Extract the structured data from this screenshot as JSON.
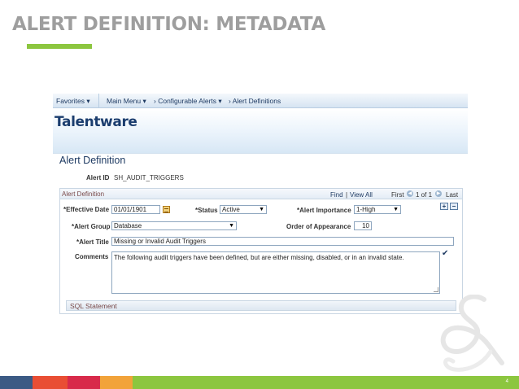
{
  "slide": {
    "title": "ALERT DEFINITION: METADATA",
    "page_number": "4",
    "colors": {
      "title": "#9e9e9e",
      "accent_green": "#8cc63f",
      "footer": [
        "#3b5a84",
        "#e94e34",
        "#d82a4a",
        "#f2a33a",
        "#8cc63f"
      ]
    }
  },
  "topnav": {
    "favorites": "Favorites",
    "main_menu": "Main Menu",
    "crumb_1": "Configurable Alerts",
    "crumb_2": "Alert Definitions"
  },
  "brand": {
    "logo": "Talentware"
  },
  "page": {
    "heading": "Alert Definition",
    "alert_id_label": "Alert ID",
    "alert_id_value": "SH_AUDIT_TRIGGERS"
  },
  "group": {
    "title": "Alert Definition",
    "find": "Find",
    "view_all": "View All",
    "first": "First",
    "paging": "1 of 1",
    "last": "Last"
  },
  "form": {
    "effective_date_label": "*Effective Date",
    "effective_date_value": "01/01/1901",
    "status_label": "*Status",
    "status_value": "Active",
    "importance_label": "*Alert Importance",
    "importance_value": "1-High",
    "alert_group_label": "*Alert Group",
    "alert_group_value": "Database",
    "order_label": "Order of Appearance",
    "order_value": "10",
    "alert_title_label": "*Alert Title",
    "alert_title_value": "Missing or Invalid Audit Triggers",
    "comments_label": "Comments",
    "comments_value": "The following audit triggers have been defined, but are either missing, disabled, or in an invalid state."
  },
  "sql_section": {
    "label": "SQL Statement"
  },
  "icons": {
    "add": "plus-icon",
    "remove": "minus-icon",
    "calendar": "calendar-icon",
    "spellcheck": "spellcheck-icon",
    "dropdown": "chevron-down-icon"
  }
}
